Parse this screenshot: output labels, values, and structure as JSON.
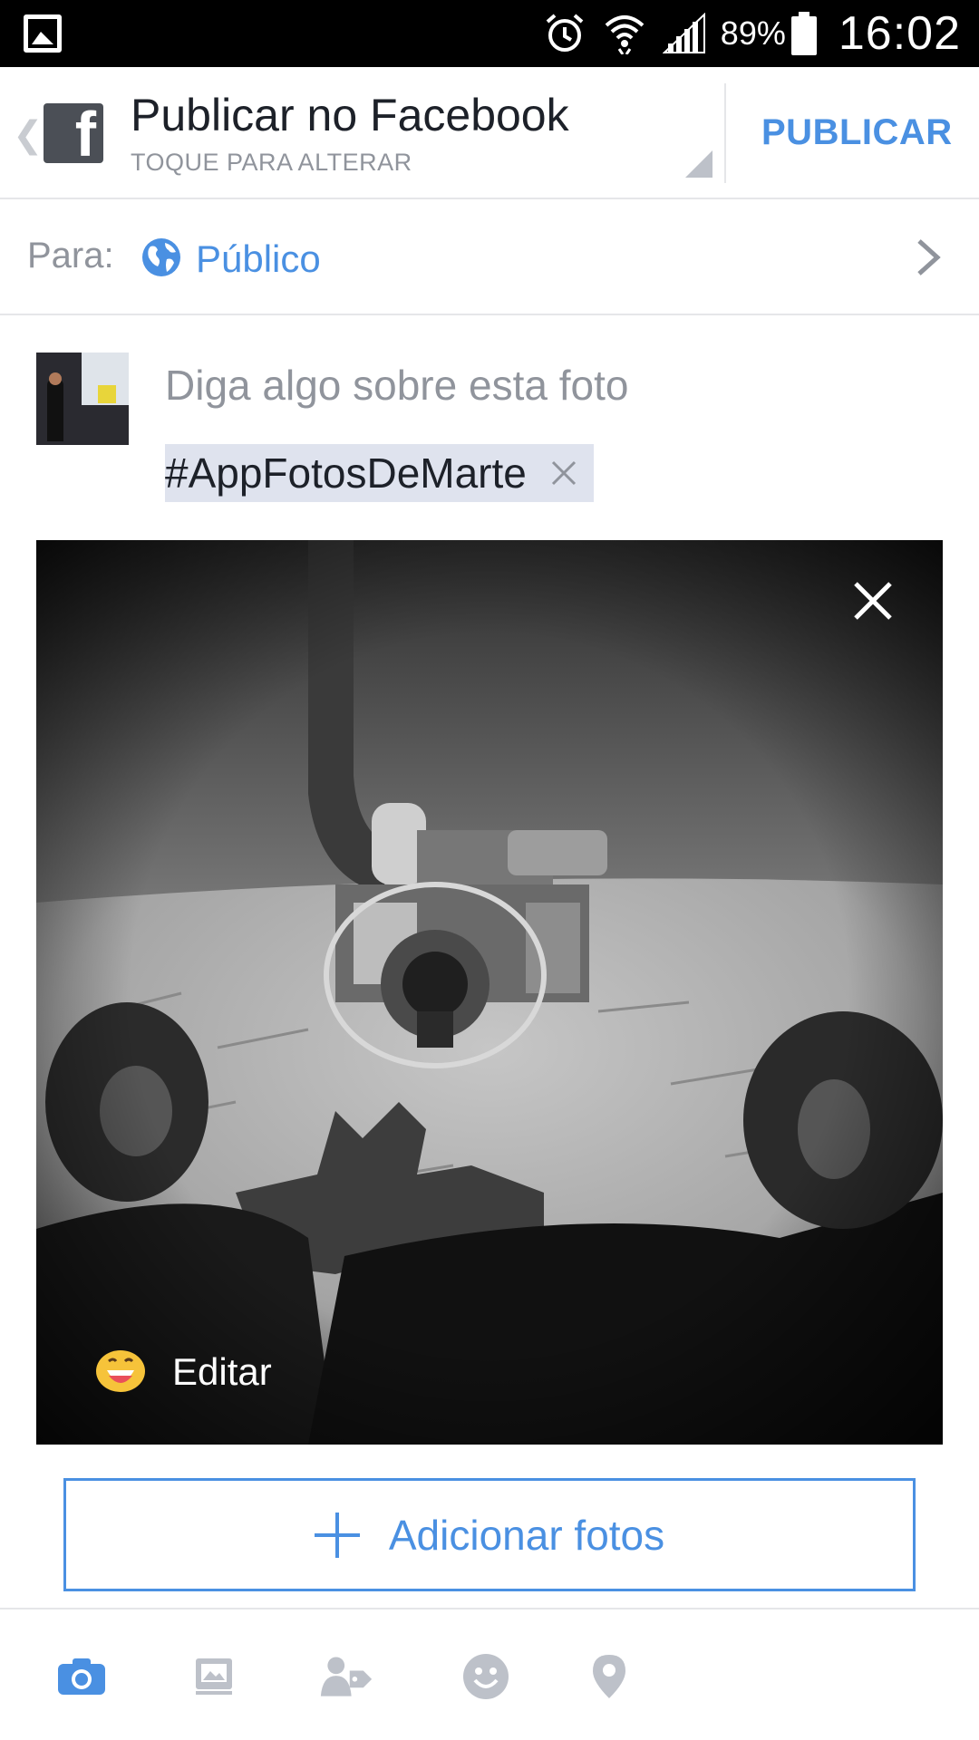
{
  "status_bar": {
    "battery_percent": "89%",
    "time": "16:02",
    "icons": [
      "gallery-icon",
      "alarm-icon",
      "wifi-icon",
      "signal-icon",
      "battery-icon"
    ]
  },
  "header": {
    "title": "Publicar no Facebook",
    "subtitle": "TOQUE PARA ALTERAR",
    "logo_letter": "f",
    "publish_label": "PUBLICAR"
  },
  "audience": {
    "label": "Para:",
    "value": "Público"
  },
  "composer": {
    "placeholder": "Diga algo sobre esta foto",
    "hashtag": "#AppFotosDeMarte"
  },
  "photo": {
    "edit_label": "Editar"
  },
  "add_photos": {
    "label": "Adicionar fotos"
  },
  "toolbar": {
    "items": [
      "camera-icon",
      "gallery-icon",
      "tag-people-icon",
      "emoji-icon",
      "location-icon"
    ]
  },
  "colors": {
    "accent": "#4a90e2",
    "status_bar": "#000000",
    "muted_text": "#90949c",
    "hashtag_bg": "#dfe3ee",
    "toolbar_active": "#4a90e2",
    "toolbar_inactive": "#bdc1c9"
  }
}
